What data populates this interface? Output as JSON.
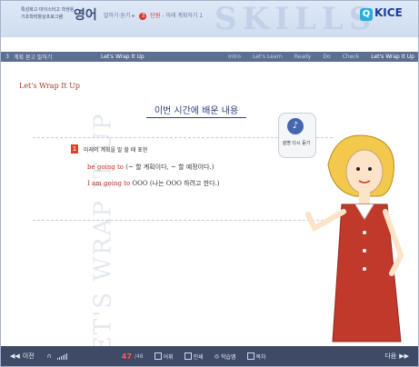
{
  "header": {
    "program_line1": "특성화고·마이스터고 학생용",
    "program_line2": "기초학력향상프로그램",
    "subject": "영어",
    "breadcrumb_section": "말하기·듣기",
    "unit_number": "3",
    "unit_label": "단원",
    "unit_title": "미래 계획하기 1",
    "logo_text": "KICE"
  },
  "nav": {
    "unit_number": "3",
    "unit_title": "계획 묻고 말하기",
    "lesson": "Let's Wrap It Up",
    "steps": [
      {
        "label": "Intro",
        "active": false
      },
      {
        "label": "Let's Learn",
        "active": false
      },
      {
        "label": "Ready",
        "active": false
      },
      {
        "label": "Do",
        "active": false
      },
      {
        "label": "Check",
        "active": false
      },
      {
        "label": "Let's Wrap It Up",
        "active": true
      }
    ]
  },
  "content": {
    "section_title": "Let's Wrap It Up",
    "main_title": "이번 시간에 배운 내용",
    "vertical_text": "LET'S WRAP IT UP",
    "point_number": "1",
    "point_text": "미래의 계획을 말 할 때 표현",
    "example1_highlight": "be going to",
    "example1_rest": " (~ 할 계획이다, ~ 할 예정이다.)",
    "example2_highlight": "I am going to",
    "example2_rest": " OOO (나는 OOO 하려고 한다.)"
  },
  "replay": {
    "label": "설명 다시 듣기",
    "icon": "microphone-icon"
  },
  "footer": {
    "prev_label": "이전",
    "page": "47",
    "total": "/48",
    "menu1": "어휘",
    "menu2": "인쇄",
    "menu3": "학습맵",
    "menu4": "목차",
    "next_label": "다음"
  },
  "colors": {
    "accent": "#d8352f",
    "navy": "#2d3f7a",
    "nav_bar": "#5c6f93",
    "footer_bg": "#3f4a66"
  }
}
